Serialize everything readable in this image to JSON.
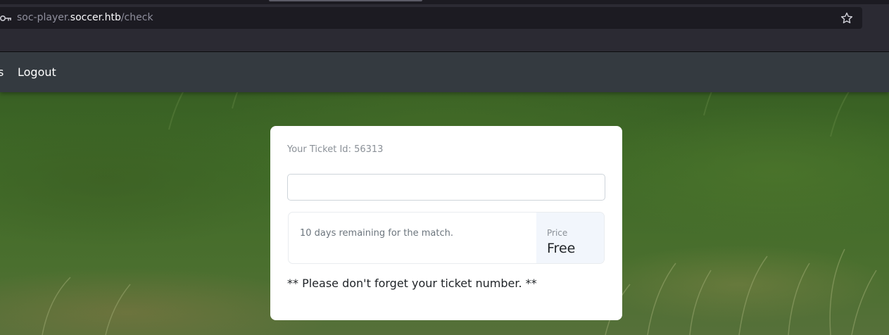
{
  "browser": {
    "url_subdomain": "soc-player.",
    "url_domain": "soccer.htb",
    "url_path": "/check",
    "key_icon": "key-icon",
    "bookmark_icon": "star-icon"
  },
  "navbar": {
    "partial_link": "s",
    "logout_label": "Logout"
  },
  "ticket_card": {
    "ticket_id_text": "Your Ticket Id: 56313",
    "input_value": "",
    "remaining_text": "10 days remaining for the match.",
    "price_label": "Price",
    "price_value": "Free",
    "reminder_text": "** Please don't forget your ticket number. **"
  },
  "colors": {
    "navbar_bg": "#343a40",
    "card_bg": "#ffffff",
    "price_box_bg": "#f2f6fc",
    "browser_chrome": "#2b2a33"
  }
}
